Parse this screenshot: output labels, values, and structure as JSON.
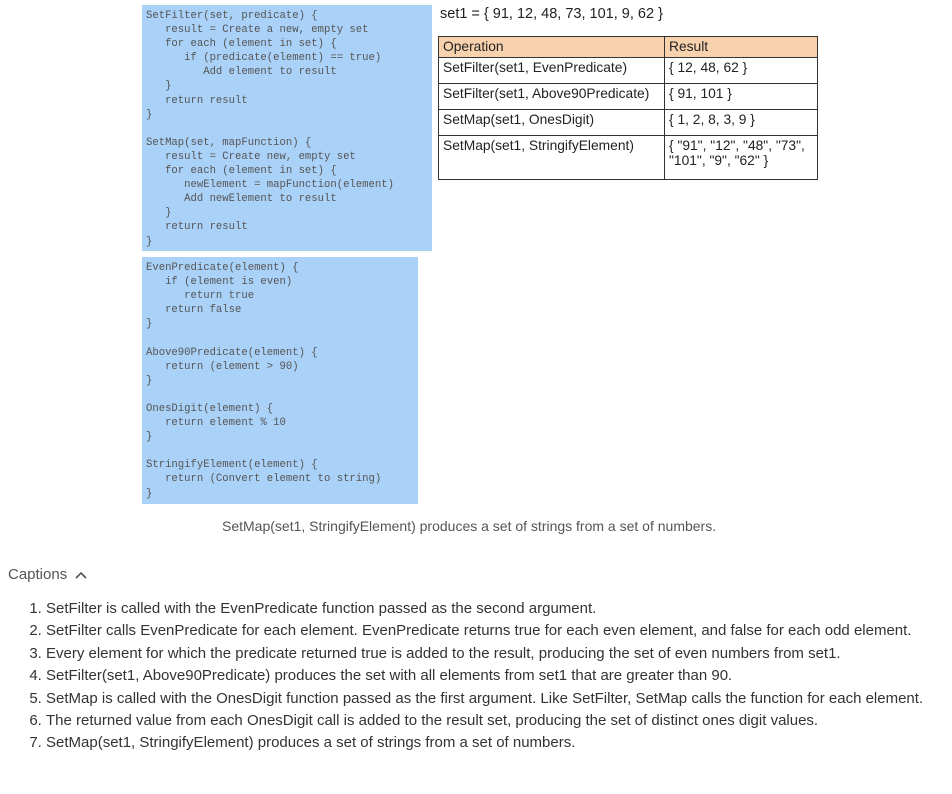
{
  "code": {
    "top": "SetFilter(set, predicate) {\n   result = Create a new, empty set\n   for each (element in set) {\n      if (predicate(element) == true)\n         Add element to result\n   }\n   return result\n}\n\nSetMap(set, mapFunction) {\n   result = Create new, empty set\n   for each (element in set) {\n      newElement = mapFunction(element)\n      Add newElement to result\n   }\n   return result\n}",
    "bottom": "EvenPredicate(element) {\n   if (element is even)\n      return true\n   return false\n}\n\nAbove90Predicate(element) {\n   return (element > 90)\n}\n\nOnesDigit(element) {\n   return element % 10\n}\n\nStringifyElement(element) {\n   return (Convert element to string)\n}"
  },
  "set_definition": "set1 = { 91, 12, 48, 73, 101, 9, 62 }",
  "table": {
    "headers": [
      "Operation",
      "Result"
    ],
    "rows": [
      [
        "SetFilter(set1, EvenPredicate)",
        "{ 12, 48, 62 }"
      ],
      [
        "SetFilter(set1, Above90Predicate)",
        "{ 91, 101 }"
      ],
      [
        "SetMap(set1, OnesDigit)",
        "{ 1, 2, 8, 3, 9 }"
      ],
      [
        "SetMap(set1, StringifyElement)",
        "{ \"91\", \"12\", \"48\", \"73\", \"101\", \"9\", \"62\" }"
      ]
    ]
  },
  "figure_caption": "SetMap(set1, StringifyElement) produces a set of strings from a set of numbers.",
  "captions": {
    "toggle_label": "Captions",
    "toggle_icon": "chevron-up-icon",
    "items": [
      "SetFilter is called with the EvenPredicate function passed as the second argument.",
      "SetFilter calls EvenPredicate for each element. EvenPredicate returns true for each even element, and false for each odd element.",
      "Every element for which the predicate returned true is added to the result, producing the set of even numbers from set1.",
      "SetFilter(set1, Above90Predicate) produces the set with all elements from set1 that are greater than 90.",
      "SetMap is called with the OnesDigit function passed as the first argument. Like SetFilter, SetMap calls the function for each element.",
      "The returned value from each OnesDigit call is added to the result set, producing the set of distinct ones digit values.",
      "SetMap(set1, StringifyElement) produces a set of strings from a set of numbers."
    ]
  },
  "colors": {
    "code_background": "#aad1f7",
    "table_header_background": "#f8d1ad"
  }
}
